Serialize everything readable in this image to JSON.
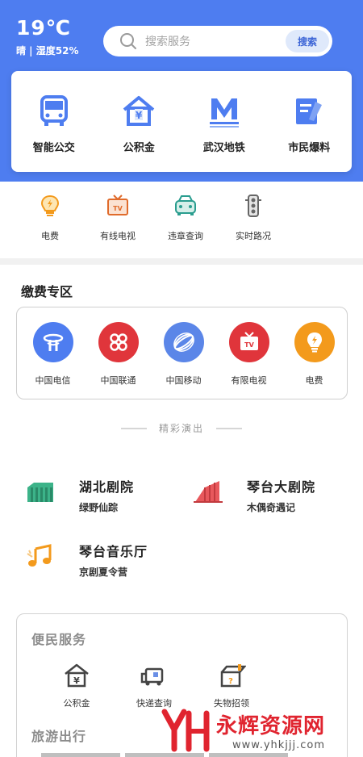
{
  "weather": {
    "temperature": "19℃",
    "description": "晴 | 湿度52%"
  },
  "search": {
    "placeholder": "搜索服务",
    "button": "搜索"
  },
  "main_services": [
    {
      "label": "智能公交",
      "icon": "bus-icon"
    },
    {
      "label": "公积金",
      "icon": "housing-fund-icon"
    },
    {
      "label": "武汉地铁",
      "icon": "metro-icon"
    },
    {
      "label": "市民爆料",
      "icon": "report-icon"
    }
  ],
  "quick_services": [
    {
      "label": "电费",
      "icon": "electricity-bulb-icon"
    },
    {
      "label": "有线电视",
      "icon": "tv-icon"
    },
    {
      "label": "违章查询",
      "icon": "car-icon"
    },
    {
      "label": "实时路况",
      "icon": "traffic-light-icon"
    }
  ],
  "payment": {
    "title": "缴费专区",
    "items": [
      {
        "label": "中国电信",
        "icon": "china-telecom-icon",
        "color": "#4e7df0"
      },
      {
        "label": "中国联通",
        "icon": "china-unicom-icon",
        "color": "#e0353b"
      },
      {
        "label": "中国移动",
        "icon": "china-mobile-icon",
        "color": "#5b86e8"
      },
      {
        "label": "有限电视",
        "icon": "tv-icon",
        "color": "#e0353b"
      },
      {
        "label": "电费",
        "icon": "electricity-bulb-icon",
        "color": "#f39a1c"
      }
    ]
  },
  "performances": {
    "title": "精彩演出",
    "venues": [
      {
        "name": "湖北剧院",
        "show": "绿野仙踪",
        "icon": "theater-building-icon"
      },
      {
        "name": "琴台大剧院",
        "show": "木偶奇遇记",
        "icon": "grand-theater-icon"
      },
      {
        "name": "琴台音乐厅",
        "show": "京剧夏令营",
        "icon": "music-note-icon"
      }
    ]
  },
  "convenience": {
    "title": "便民服务",
    "items": [
      {
        "label": "公积金",
        "icon": "housing-fund-icon"
      },
      {
        "label": "快递查询",
        "icon": "delivery-truck-icon"
      },
      {
        "label": "失物招领",
        "icon": "lost-found-box-icon"
      }
    ],
    "travel_title": "旅游出行"
  },
  "watermark": {
    "name": "永辉资源网",
    "url": "www.yhkjjj.com"
  },
  "colors": {
    "primary": "#4e7df0",
    "accent_red": "#e0353b",
    "accent_orange": "#f39a1c",
    "teal": "#2a9d8f"
  }
}
